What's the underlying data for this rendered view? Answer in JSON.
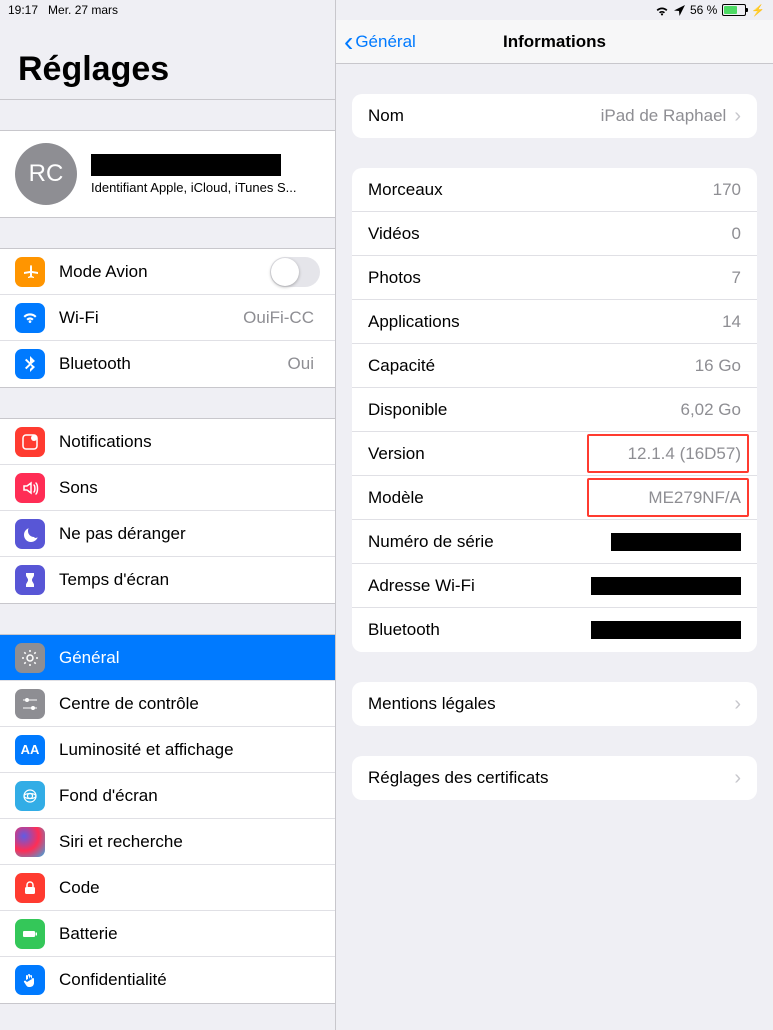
{
  "status": {
    "time": "19:17",
    "date": "Mer. 27 mars",
    "battery_pct": "56 %"
  },
  "left": {
    "title": "Réglages",
    "profile": {
      "initials": "RC",
      "subtitle": "Identifiant Apple, iCloud, iTunes S..."
    },
    "airplane": {
      "label": "Mode Avion"
    },
    "wifi": {
      "label": "Wi-Fi",
      "value": "OuiFi-CC"
    },
    "bluetooth": {
      "label": "Bluetooth",
      "value": "Oui"
    },
    "notifications": {
      "label": "Notifications"
    },
    "sounds": {
      "label": "Sons"
    },
    "dnd": {
      "label": "Ne pas déranger"
    },
    "screentime": {
      "label": "Temps d'écran"
    },
    "general": {
      "label": "Général"
    },
    "controlcenter": {
      "label": "Centre de contrôle"
    },
    "display": {
      "label": "Luminosité et affichage"
    },
    "wallpaper": {
      "label": "Fond d'écran"
    },
    "siri": {
      "label": "Siri et recherche"
    },
    "passcode": {
      "label": "Code"
    },
    "battery": {
      "label": "Batterie"
    },
    "privacy": {
      "label": "Confidentialité"
    }
  },
  "right": {
    "back": "Général",
    "title": "Informations",
    "name": {
      "label": "Nom",
      "value": "iPad de Raphael"
    },
    "songs": {
      "label": "Morceaux",
      "value": "170"
    },
    "videos": {
      "label": "Vidéos",
      "value": "0"
    },
    "photos": {
      "label": "Photos",
      "value": "7"
    },
    "apps": {
      "label": "Applications",
      "value": "14"
    },
    "capacity": {
      "label": "Capacité",
      "value": "16 Go"
    },
    "available": {
      "label": "Disponible",
      "value": "6,02 Go"
    },
    "version": {
      "label": "Version",
      "value": "12.1.4 (16D57)"
    },
    "model": {
      "label": "Modèle",
      "value": "ME279NF/A"
    },
    "serial": {
      "label": "Numéro de série"
    },
    "wifi_addr": {
      "label": "Adresse Wi-Fi"
    },
    "bt_addr": {
      "label": "Bluetooth"
    },
    "legal": {
      "label": "Mentions légales"
    },
    "cert": {
      "label": "Réglages des certificats"
    }
  }
}
